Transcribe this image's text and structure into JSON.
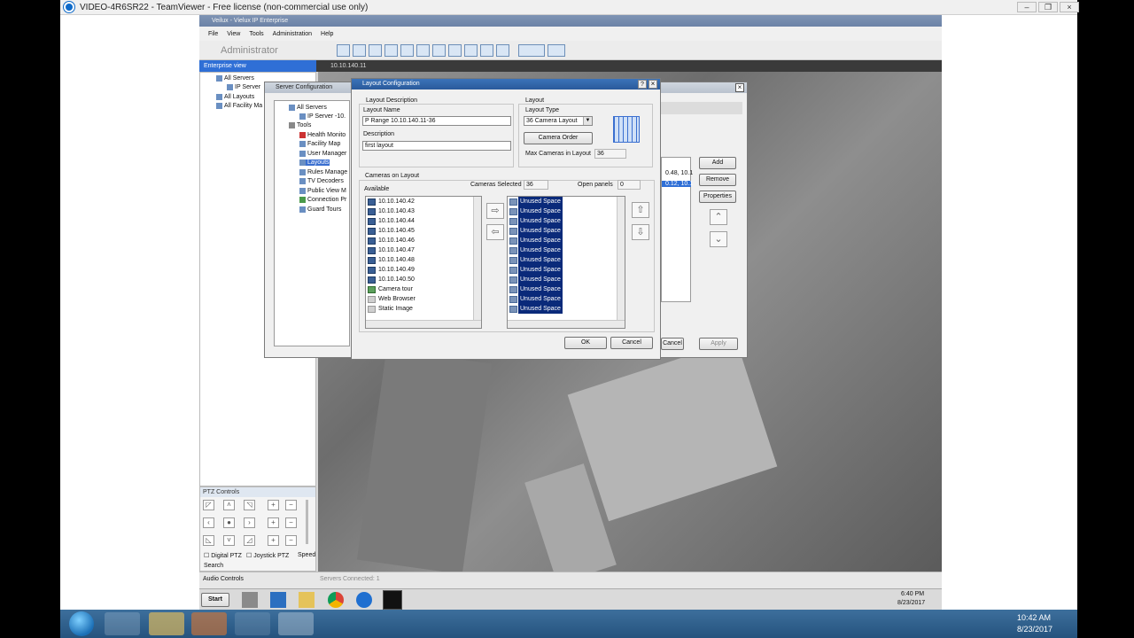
{
  "teamviewer": {
    "title": "VIDEO-4R6SR22 - TeamViewer - Free license (non-commercial use only)"
  },
  "app": {
    "title": "Veilux - Vielux IP Enterprise",
    "menu": [
      "File",
      "View",
      "Tools",
      "Administration",
      "Help"
    ],
    "user": "Administrator",
    "enterprise_view": "Enterprise view",
    "view_tab": "10.10.140.11"
  },
  "tree": {
    "all_servers": "All Servers",
    "ip_server": "IP Server",
    "all_layouts": "All Layouts",
    "all_facility": "All Facility Ma"
  },
  "server_config": {
    "title": "Server Configuration",
    "tree": {
      "all_servers": "All Servers",
      "ip_server": "IP Server -10.",
      "tools": "Tools",
      "items": [
        "Health Monito",
        "Facility Map",
        "User Manager",
        "Layouts",
        "Rules Manage",
        "TV Decoders",
        "Public View M",
        "Connection Pr",
        "Guard Tours"
      ]
    },
    "right_values": [
      "0.48, 10.1",
      "0.12, 10.1"
    ],
    "buttons": {
      "add": "Add",
      "remove": "Remove",
      "properties": "Properties",
      "cancel": "Cancel",
      "apply": "Apply"
    }
  },
  "layout_dialog": {
    "title": "Layout Configuration",
    "help": "?",
    "close": "×",
    "description_group": "Layout Description",
    "layout_name_label": "Layout Name",
    "layout_name_value": "P Range 10.10.140.11-36",
    "description_label": "Description",
    "description_value": "first layout",
    "layout_group": "Layout",
    "layout_type_label": "Layout Type",
    "layout_type_value": "36 Camera Layout",
    "camera_order_button": "Camera Order",
    "max_cameras_label": "Max Cameras in Layout",
    "max_cameras_value": "36",
    "cameras_group": "Cameras on Layout",
    "cameras_selected_label": "Cameras Selected",
    "cameras_selected_value": "36",
    "open_panels_label": "Open panels",
    "open_panels_value": "0",
    "available_label": "Available",
    "available": [
      {
        "label": "10.10.140.42",
        "icon": "camera-icon"
      },
      {
        "label": "10.10.140.43",
        "icon": "camera-icon"
      },
      {
        "label": "10.10.140.44",
        "icon": "camera-icon"
      },
      {
        "label": "10.10.140.45",
        "icon": "camera-icon"
      },
      {
        "label": "10.10.140.46",
        "icon": "camera-icon"
      },
      {
        "label": "10.10.140.47",
        "icon": "camera-icon"
      },
      {
        "label": "10.10.140.48",
        "icon": "camera-icon"
      },
      {
        "label": "10.10.140.49",
        "icon": "camera-icon"
      },
      {
        "label": "10.10.140.50",
        "icon": "camera-icon"
      },
      {
        "label": "Camera tour",
        "icon": "camera-tour-icon"
      },
      {
        "label": "Web Browser",
        "icon": "web-browser-icon"
      },
      {
        "label": "Static Image",
        "icon": "static-image-icon"
      }
    ],
    "selected": [
      "Unused Space",
      "Unused Space",
      "Unused Space",
      "Unused Space",
      "Unused Space",
      "Unused Space",
      "Unused Space",
      "Unused Space",
      "Unused Space",
      "Unused Space",
      "Unused Space",
      "Unused Space"
    ],
    "ok_button": "OK",
    "cancel_button": "Cancel"
  },
  "ptz": {
    "title": "PTZ Controls",
    "digital": "Digital PTZ",
    "joystick": "Joystick PTZ",
    "speed": "Speed",
    "search": "Search",
    "audio": "Audio Controls"
  },
  "status": {
    "servers_connected": "Servers Connected: 1"
  },
  "inner_taskbar": {
    "start": "Start",
    "time": "6:40 PM",
    "date": "8/23/2017"
  },
  "windows_taskbar": {
    "time": "10:42 AM",
    "date": "8/23/2017"
  },
  "colors": {
    "selection": "#0a2a7a",
    "accent": "#2f6fd6"
  }
}
